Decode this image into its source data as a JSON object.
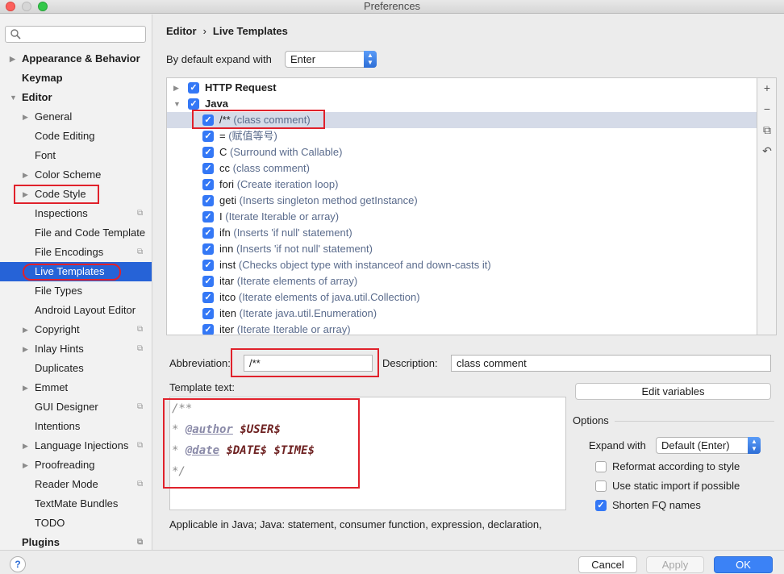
{
  "window": {
    "title": "Preferences"
  },
  "sidebar": {
    "search_placeholder": "",
    "items": [
      {
        "label": "Appearance & Behavior",
        "level": 0,
        "arrow": "right",
        "bold": true
      },
      {
        "label": "Keymap",
        "level": 0,
        "bold": true
      },
      {
        "label": "Editor",
        "level": 0,
        "arrow": "down",
        "bold": true
      },
      {
        "label": "General",
        "level": 1,
        "arrow": "right"
      },
      {
        "label": "Code Editing",
        "level": 1
      },
      {
        "label": "Font",
        "level": 1
      },
      {
        "label": "Color Scheme",
        "level": 1,
        "arrow": "right"
      },
      {
        "label": "Code Style",
        "level": 1,
        "arrow": "right"
      },
      {
        "label": "Inspections",
        "level": 1,
        "badge": true
      },
      {
        "label": "File and Code Template",
        "level": 1
      },
      {
        "label": "File Encodings",
        "level": 1,
        "badge": true
      },
      {
        "label": "Live Templates",
        "level": 1,
        "selected": true
      },
      {
        "label": "File Types",
        "level": 1
      },
      {
        "label": "Android Layout Editor",
        "level": 1
      },
      {
        "label": "Copyright",
        "level": 1,
        "arrow": "right",
        "badge": true
      },
      {
        "label": "Inlay Hints",
        "level": 1,
        "arrow": "right",
        "badge": true
      },
      {
        "label": "Duplicates",
        "level": 1
      },
      {
        "label": "Emmet",
        "level": 1,
        "arrow": "right"
      },
      {
        "label": "GUI Designer",
        "level": 1,
        "badge": true
      },
      {
        "label": "Intentions",
        "level": 1
      },
      {
        "label": "Language Injections",
        "level": 1,
        "arrow": "right",
        "badge": true
      },
      {
        "label": "Proofreading",
        "level": 1,
        "arrow": "right"
      },
      {
        "label": "Reader Mode",
        "level": 1,
        "badge": true
      },
      {
        "label": "TextMate Bundles",
        "level": 1
      },
      {
        "label": "TODO",
        "level": 1
      },
      {
        "label": "Plugins",
        "level": 0,
        "bold": true,
        "badge": true
      }
    ]
  },
  "breadcrumb": {
    "parent": "Editor",
    "separator": "›",
    "current": "Live Templates"
  },
  "expand": {
    "label": "By default expand with",
    "value": "Enter"
  },
  "templates": {
    "groups": [
      {
        "name": "HTTP Request",
        "expanded": false,
        "checked": true
      },
      {
        "name": "Java",
        "expanded": true,
        "checked": true
      }
    ],
    "items": [
      {
        "abbr": "/**",
        "desc": "(class comment)",
        "checked": true,
        "selected": true
      },
      {
        "abbr": "=",
        "desc": "(赋值等号)",
        "checked": true
      },
      {
        "abbr": "C",
        "desc": "(Surround with Callable)",
        "checked": true
      },
      {
        "abbr": "cc",
        "desc": "(class comment)",
        "checked": true
      },
      {
        "abbr": "fori",
        "desc": "(Create iteration loop)",
        "checked": true
      },
      {
        "abbr": "geti",
        "desc": "(Inserts singleton method getInstance)",
        "checked": true
      },
      {
        "abbr": "I",
        "desc": "(Iterate Iterable or array)",
        "checked": true
      },
      {
        "abbr": "ifn",
        "desc": "(Inserts 'if null' statement)",
        "checked": true
      },
      {
        "abbr": "inn",
        "desc": "(Inserts 'if not null' statement)",
        "checked": true
      },
      {
        "abbr": "inst",
        "desc": "(Checks object type with instanceof and down-casts it)",
        "checked": true
      },
      {
        "abbr": "itar",
        "desc": "(Iterate elements of array)",
        "checked": true
      },
      {
        "abbr": "itco",
        "desc": "(Iterate elements of java.util.Collection)",
        "checked": true
      },
      {
        "abbr": "iten",
        "desc": "(Iterate java.util.Enumeration)",
        "checked": true
      },
      {
        "abbr": "iter",
        "desc": "(Iterate Iterable or array)",
        "checked": true
      }
    ],
    "tools": {
      "add": "+",
      "remove": "−",
      "copy": "⧉",
      "restore": "↶"
    }
  },
  "abbreviation": {
    "label": "Abbreviation:",
    "value": "/**"
  },
  "description": {
    "label": "Description:",
    "value": "class comment"
  },
  "template_text": {
    "label": "Template text:",
    "line1": "/**",
    "line2_prefix": "* ",
    "line2_tag": "@author",
    "line2_var": "$USER$",
    "line3_prefix": "* ",
    "line3_tag": "@date",
    "line3_var": "$DATE$ $TIME$",
    "line4": "*/"
  },
  "edit_variables": "Edit variables",
  "options": {
    "label": "Options",
    "expand_with_label": "Expand with",
    "expand_with_value": "Default (Enter)",
    "reformat": {
      "label": "Reformat according to style",
      "checked": false
    },
    "static_import": {
      "label": "Use static import if possible",
      "checked": false
    },
    "shorten_fq": {
      "label": "Shorten FQ names",
      "checked": true
    }
  },
  "applicable": "Applicable in Java; Java: statement, consumer function, expression, declaration,",
  "footer": {
    "help": "?",
    "cancel": "Cancel",
    "apply": "Apply",
    "ok": "OK"
  },
  "colors": {
    "accent": "#2663d7",
    "highlight": "#e0212b",
    "checkbox": "#3478f6"
  }
}
